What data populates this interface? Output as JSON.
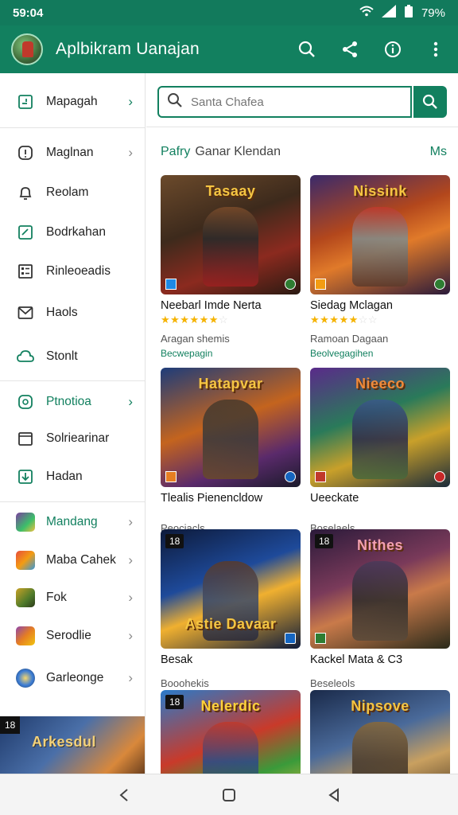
{
  "status_bar": {
    "time": "59:04",
    "battery": "79%"
  },
  "app_bar": {
    "title": "Aplbikram Uanajan"
  },
  "colors": {
    "primary": "#12805f",
    "accent_star": "#f5b301"
  },
  "sidebar": {
    "items": [
      {
        "label": "Mapagah",
        "icon": "clipboard-icon",
        "chevron": "›"
      },
      {
        "label": "Maglnan",
        "icon": "info-card-icon",
        "chevron": "›"
      },
      {
        "label": "Reolam",
        "icon": "bell-icon"
      },
      {
        "label": "Bodrkahan",
        "icon": "edit-box-icon"
      },
      {
        "label": "Rinleoeadis",
        "icon": "grid-list-icon"
      },
      {
        "label": "Haols",
        "icon": "mail-icon"
      },
      {
        "label": "Stonlt",
        "icon": "cloud-icon"
      },
      {
        "label": "Ptnotioa",
        "icon": "timer-icon",
        "chevron": "›"
      },
      {
        "label": "Solriearinar",
        "icon": "calendar-icon"
      },
      {
        "label": "Hadan",
        "icon": "download-icon"
      },
      {
        "label": "Mandang",
        "icon": "game-icon-1",
        "chevron": "›"
      },
      {
        "label": "Maba Cahek",
        "icon": "game-icon-2",
        "chevron": "›"
      },
      {
        "label": "Fok",
        "icon": "game-icon-3",
        "chevron": "›"
      },
      {
        "label": "Serodlie",
        "icon": "game-icon-4",
        "chevron": "›"
      },
      {
        "label": "Garleonge",
        "icon": "game-icon-5",
        "chevron": "›"
      }
    ],
    "banner": {
      "age": "18",
      "title": "Arkesdul"
    }
  },
  "search": {
    "placeholder": "Santa Chafea"
  },
  "section": {
    "title_lead": "Pafry",
    "title_rest": "Ganar Klendan",
    "more": "Ms"
  },
  "games": [
    {
      "name": "Neebarl Imde Nerta",
      "logo": "Tasaay",
      "stars": 5,
      "subtitle": "Aragan shemis",
      "tag": "Becwepagin"
    },
    {
      "name": "Siedag Mclagan",
      "logo": "Nissink",
      "stars": 4,
      "subtitle": "Ramoan Dagaan",
      "tag": "Beolvegagihen"
    },
    {
      "name": "Tlealis Pienencldow",
      "logo": "Hatapvar",
      "subtitle": "Peociacls"
    },
    {
      "name": "Ueeckate",
      "logo": "Nieeco",
      "subtitle": "Boselaels"
    },
    {
      "name": "Besak",
      "logo": "Astie Davaar",
      "age": "18",
      "subtitle": "Booohekis"
    },
    {
      "name": "Kackel Mata & C3",
      "logo": "Nithes",
      "age": "18",
      "subtitle": "Beseleols"
    },
    {
      "name": "",
      "logo": "Nelerdic",
      "age": "18"
    },
    {
      "name": "",
      "logo": "Nipsove"
    }
  ],
  "nav": {
    "back": "back-icon",
    "home": "home-icon",
    "recents": "recents-icon"
  }
}
